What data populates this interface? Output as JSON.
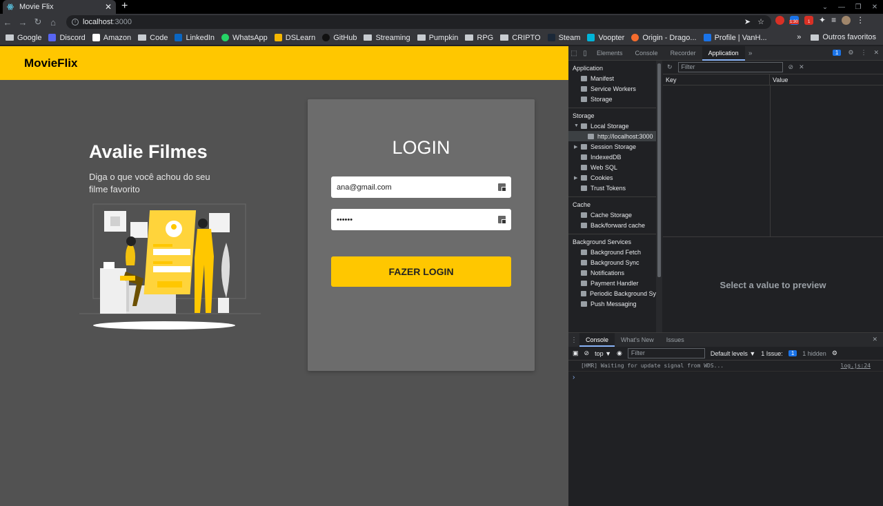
{
  "browser": {
    "tab_title": "Movie Flix",
    "new_tab": "+",
    "url_host": "localhost",
    "url_port": ":3000",
    "bookmarks": [
      "Google",
      "Discord",
      "Amazon",
      "Code",
      "LinkedIn",
      "WhatsApp",
      "DSLearn",
      "GitHub",
      "Streaming",
      "Pumpkin",
      "RPG",
      "CRIPTO",
      "Steam",
      "Voopter",
      "Origin - Drago...",
      "Profile | VanH..."
    ],
    "bookmarks_more": "»",
    "other_favorites": "Outros favoritos",
    "ext_badge_1": "1:30",
    "ext_badge_2": "1"
  },
  "app": {
    "brand": "MovieFlix",
    "hero_title": "Avalie Filmes",
    "hero_subtitle": "Diga o que você achou do seu filme favorito",
    "login_title": "LOGIN",
    "email_value": "ana@gmail.com",
    "password_value": "••••••",
    "login_button": "FAZER LOGIN"
  },
  "devtools": {
    "tabs": [
      "Elements",
      "Console",
      "Recorder",
      "Application"
    ],
    "tabs_more": "»",
    "issues_count": "1",
    "sections": {
      "application": "Application",
      "application_items": [
        "Manifest",
        "Service Workers",
        "Storage"
      ],
      "storage": "Storage",
      "local_storage": "Local Storage",
      "local_storage_origin": "http://localhost:3000",
      "storage_items": [
        "Session Storage",
        "IndexedDB",
        "Web SQL",
        "Cookies",
        "Trust Tokens"
      ],
      "cache": "Cache",
      "cache_items": [
        "Cache Storage",
        "Back/forward cache"
      ],
      "background": "Background Services",
      "background_items": [
        "Background Fetch",
        "Background Sync",
        "Notifications",
        "Payment Handler",
        "Periodic Background Sy",
        "Push Messaging"
      ]
    },
    "filter_placeholder": "Filter",
    "col_key": "Key",
    "col_value": "Value",
    "preview_text": "Select a value to preview",
    "drawer_tabs": [
      "Console",
      "What's New",
      "Issues"
    ],
    "context": "top ▼",
    "console_filter": "Filter",
    "levels": "Default levels ▼",
    "issue_label": "1 Issue:",
    "issue_count": "1",
    "hidden": "1 hidden",
    "log_message": "[HMR] Waiting for update signal from WDS...",
    "log_source": "log.js:24",
    "prompt": "›"
  }
}
